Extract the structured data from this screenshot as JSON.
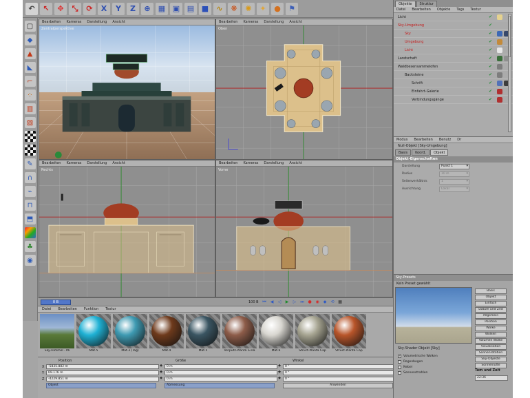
{
  "top_toolbar": {
    "icons": [
      "undo-icon",
      "select-arrow-icon",
      "move-icon",
      "scale-icon",
      "rotate-icon",
      "axis-x-icon",
      "axis-y-icon",
      "axis-z-icon",
      "world-axis-icon",
      "render-region-icon",
      "render-view-icon",
      "render-settings-icon",
      "cube-primitive-icon",
      "spline-icon",
      "nurbs-icon",
      "light-icon",
      "deformer-icon",
      "scene-icon",
      "camera-icon"
    ]
  },
  "left_toolbar": {
    "icons": [
      "camera-mode-icon",
      "model-mode-icon",
      "object-mode-icon",
      "texture-mode-icon",
      "axis-mode-icon",
      "point-mode-icon",
      "edge-mode-icon",
      "polygon-mode-icon",
      "checker-icon",
      "checker-icon",
      "tweak-icon",
      "magnet-icon",
      "knife-icon",
      "bridge-icon",
      "extrude-icon",
      "material-icon",
      "paint-icon",
      "sculpt-icon"
    ]
  },
  "viewports": {
    "perspective": {
      "label": "Zentralperspektive",
      "menu": [
        "Bearbeiten",
        "Kameras",
        "Darstellung",
        "Ansicht"
      ]
    },
    "top": {
      "label": "Oben",
      "menu": [
        "Bearbeiten",
        "Kameras",
        "Darstellung",
        "Ansicht"
      ]
    },
    "right": {
      "label": "Rechts",
      "menu": [
        "Bearbeiten",
        "Kameras",
        "Darstellung",
        "Ansicht"
      ]
    },
    "front": {
      "label": "Vorne",
      "menu": [
        "Bearbeiten",
        "Kameras",
        "Darstellung",
        "Ansicht"
      ]
    }
  },
  "timeline": {
    "current_frame": "0 B",
    "end_frame": "100 B"
  },
  "material_manager": {
    "menu": [
      "Datei",
      "Bearbeiten",
      "Funktion",
      "Textur"
    ],
    "materials": [
      {
        "name": "Sky-Himmel - Mi",
        "preview": "landscape"
      },
      {
        "name": "Mat.5",
        "color": "#1fb1d4"
      },
      {
        "name": "Mat.3 (Tag)",
        "color": "#3e9ab2"
      },
      {
        "name": "Mat.4",
        "color": "#6e3a1c"
      },
      {
        "name": "Mat.5",
        "color": "#3a5562"
      },
      {
        "name": "Verputz-Planta S-Ha",
        "color": "#8d5c49"
      },
      {
        "name": "Mat.6",
        "color": "#d8d6d0"
      },
      {
        "name": "Struct-Planta Cap",
        "color": "#a6a491"
      },
      {
        "name": "Struct-Planta Cap",
        "color": "#b8552a"
      }
    ]
  },
  "coord_manager": {
    "headers": [
      "Position",
      "Größe",
      "Winkel"
    ],
    "rows": [
      {
        "axis": "X",
        "position": "-5835.882 m",
        "size": "0 m",
        "angle": "0 °"
      },
      {
        "axis": "Y",
        "position": "69.176 m",
        "size": "0 m",
        "angle": "0 °"
      },
      {
        "axis": "Z",
        "position": "-4229.851 m",
        "size": "0 m",
        "angle": "0 °"
      }
    ],
    "mode": "Objekt",
    "size_mode": "Abmessung",
    "apply": "Anwenden"
  },
  "object_manager": {
    "tabs": [
      "Objekte",
      "Struktur"
    ],
    "menu": [
      "Datei",
      "Bearbeiten",
      "Objekte",
      "Tags",
      "Textur"
    ],
    "objects": [
      {
        "name": "Licht",
        "indent": 0,
        "color": "#1a1a1a",
        "tags": [
          "#e5d28f"
        ]
      },
      {
        "name": "Sky-Umgebung",
        "indent": 0,
        "color": "#c41e1e",
        "tags": []
      },
      {
        "name": "Sky",
        "indent": 1,
        "color": "#c41e1e",
        "tags": [
          "#3d68b5",
          "#37486b"
        ]
      },
      {
        "name": "Umgebung",
        "indent": 1,
        "color": "#c41e1e",
        "tags": [
          "#c38a3a"
        ]
      },
      {
        "name": "Licht",
        "indent": 1,
        "color": "#c41e1e",
        "tags": [
          "#e6e6e6"
        ]
      },
      {
        "name": "Landschaft",
        "indent": 0,
        "color": "#1a1a1a",
        "tags": [
          "#3b6f3b",
          "#8f8f8f"
        ]
      },
      {
        "name": "Waldbesensammelofen",
        "indent": 0,
        "color": "#1a1a1a",
        "tags": [
          "#7d7d7d"
        ]
      },
      {
        "name": "Backsteine",
        "indent": 1,
        "color": "#1a1a1a",
        "tags": [
          "#7d7d7d"
        ]
      },
      {
        "name": "Schrift",
        "indent": 2,
        "color": "#1a1a1a",
        "tags": [
          "#5271b8",
          "#3d3d3d"
        ]
      },
      {
        "name": "Einfahrt-Galerie",
        "indent": 2,
        "color": "#1a1a1a",
        "tags": [
          "#b03030"
        ]
      },
      {
        "name": "Verbindungsgänge",
        "indent": 2,
        "color": "#1a1a1a",
        "tags": [
          "#b03030"
        ]
      }
    ]
  },
  "attribute_manager": {
    "menu": [
      "Modus",
      "Bearbeiten",
      "Benutz",
      "Dr"
    ],
    "title": "Null-Objekt [Sky-Umgebung]",
    "tabs": [
      "Basis",
      "Koord.",
      "Objekt"
    ],
    "section": "Objekt-Eigenschaften",
    "fields": [
      {
        "label": "Darstellung",
        "value": "Punkt 1",
        "enabled": true
      },
      {
        "label": "Radius",
        "value": "10 m",
        "enabled": false
      },
      {
        "label": "Seitenverhältnis",
        "value": "1",
        "enabled": false
      },
      {
        "label": "Ausrichtung",
        "value": "Lokal",
        "enabled": false
      }
    ]
  },
  "sky_panel": {
    "header": "Sky-Presets",
    "preset": "Kein Preset gewählt",
    "buttons": [
      "Basis",
      "Objekt",
      "Einfach",
      "Datum und Zeit",
      "Allgemein",
      "Position",
      "Wolke",
      "Wolken",
      "Volumen Wolke",
      "Visualisation",
      "Sonnenrotation",
      "Sky-Objekte",
      "Sonnenlufte"
    ],
    "title": "Sky-Shader Objekt [Sky]",
    "options": [
      {
        "label": "Volumetrische Wolken",
        "checked": true
      },
      {
        "label": "Regenbogen",
        "checked": false
      },
      {
        "label": "Nebel",
        "checked": false
      },
      {
        "label": "Sonnenstrahlen",
        "checked": false
      }
    ],
    "date_title": "Tem und Zeit",
    "time": "22:36"
  }
}
